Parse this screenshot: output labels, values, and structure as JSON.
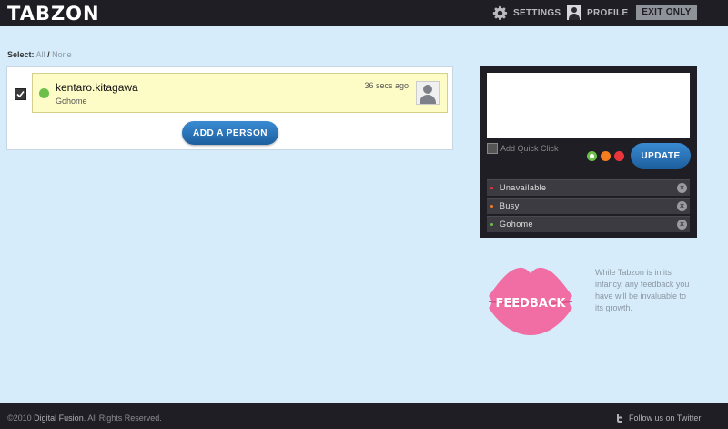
{
  "header": {
    "logo": "TABZON",
    "settings_label": "SETTINGS",
    "profile_label": "PROFILE",
    "exit_label": "EXIT ONLY"
  },
  "select": {
    "label": "Select:",
    "all": "All",
    "separator": "/",
    "none": "None"
  },
  "people": [
    {
      "name": "kentaro.kitagawa",
      "status": "Gohome",
      "time": "36 secs ago",
      "checked": true,
      "status_color": "#6cc04a"
    }
  ],
  "add_person_label": "ADD A PERSON",
  "status_panel": {
    "textarea_value": "",
    "quick_click_label": "Add Quick Click",
    "update_label": "UPDATE",
    "colors": [
      "#6cc04a",
      "#f47d20",
      "#e8363a"
    ],
    "presets": [
      {
        "label": "Unavailable",
        "color": "#e8363a"
      },
      {
        "label": "Busy",
        "color": "#f47d20"
      },
      {
        "label": "Gohome",
        "color": "#6cc04a"
      }
    ]
  },
  "feedback": {
    "label": "FEEDBACK",
    "text": "While Tabzon is in its infancy, any feedback you have will be invaluable to its growth."
  },
  "footer": {
    "copyright_prefix": "©2010",
    "owner": "Digital Fusion",
    "copyright_suffix": ". All Rights Reserved.",
    "twitter_label": "Follow us on Twitter"
  }
}
